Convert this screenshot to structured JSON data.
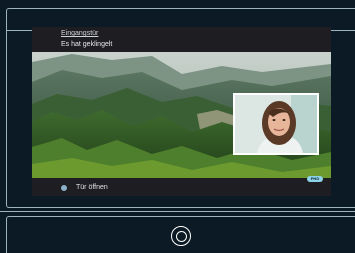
{
  "header": {
    "title": "Eingangstür",
    "subtitle": "Es hat geklingelt"
  },
  "footer": {
    "door_open_label": "Tür öffnen",
    "badge_label": "PHD"
  },
  "icons": {
    "door_action": "circle-dot-icon",
    "home_button": "home-ring-icon"
  },
  "colors": {
    "background": "#0b1a24",
    "panel": "#1e1d22",
    "accent": "#8ab1c9",
    "frame": "#9fb2bf"
  }
}
